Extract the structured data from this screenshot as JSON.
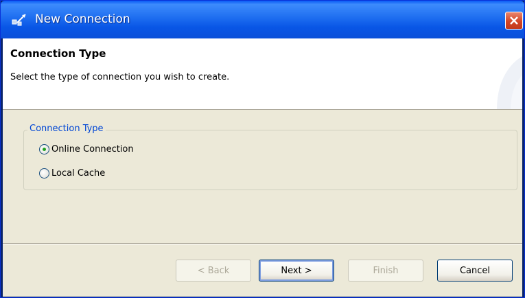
{
  "window": {
    "title": "New Connection",
    "icon": "connection-icon"
  },
  "header": {
    "title": "Connection Type",
    "subtitle": "Select the type of connection you wish to create."
  },
  "group": {
    "legend": "Connection Type",
    "options": [
      {
        "label": "Online Connection",
        "checked": true
      },
      {
        "label": "Local Cache",
        "checked": false
      }
    ]
  },
  "buttons": {
    "back": "< Back",
    "next": "Next >",
    "finish": "Finish",
    "cancel": "Cancel"
  },
  "colors": {
    "title_bar": "#1e6ef0",
    "close_button": "#d34526",
    "group_legend": "#0046d5",
    "dialog_face": "#ece9d8"
  }
}
